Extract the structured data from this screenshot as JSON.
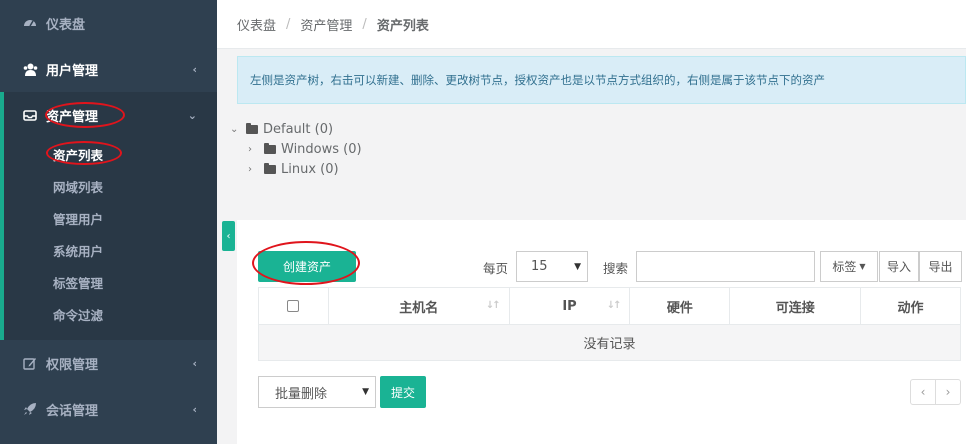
{
  "sidebar": {
    "dashboard": {
      "label": "仪表盘",
      "icon": "dashboard-icon"
    },
    "user_mgmt": {
      "label": "用户管理",
      "icon": "users-icon"
    },
    "asset_mgmt": {
      "label": "资产管理",
      "icon": "inbox-icon"
    },
    "asset_items": [
      "资产列表",
      "网域列表",
      "管理用户",
      "系统用户",
      "标签管理",
      "命令过滤"
    ],
    "perm_mgmt": {
      "label": "权限管理",
      "icon": "edit-icon"
    },
    "session_mgmt": {
      "label": "会话管理",
      "icon": "rocket-icon"
    }
  },
  "breadcrumb": [
    "仪表盘",
    "资产管理",
    "资产列表"
  ],
  "breadcrumb_sep": "/",
  "alert_text": "左侧是资产树，右击可以新建、删除、更改树节点，授权资产也是以节点方式组织的，右侧是属于该节点下的资产",
  "tree": [
    {
      "label": "Default (0)",
      "expanded": true
    },
    {
      "label": "Windows (0)",
      "expanded": false
    },
    {
      "label": "Linux (0)",
      "expanded": false
    }
  ],
  "toolbar": {
    "create_label": "创建资产",
    "per_page_label": "每页",
    "per_page_value": "15",
    "search_label": "搜索",
    "search_value": "",
    "tag_label": "标签",
    "import_label": "导入",
    "export_label": "导出"
  },
  "table": {
    "columns": [
      "",
      "主机名",
      "IP",
      "硬件",
      "可连接",
      "动作"
    ],
    "empty_text": "没有记录"
  },
  "bottom": {
    "bulk_action_value": "批量删除",
    "submit_label": "提交",
    "prev": "‹",
    "next": "›"
  },
  "colors": {
    "sidebar_bg": "#2f4050",
    "accent": "#1ab394",
    "annotation_ring": "#e0141c",
    "alert_bg": "#d9edf7"
  }
}
